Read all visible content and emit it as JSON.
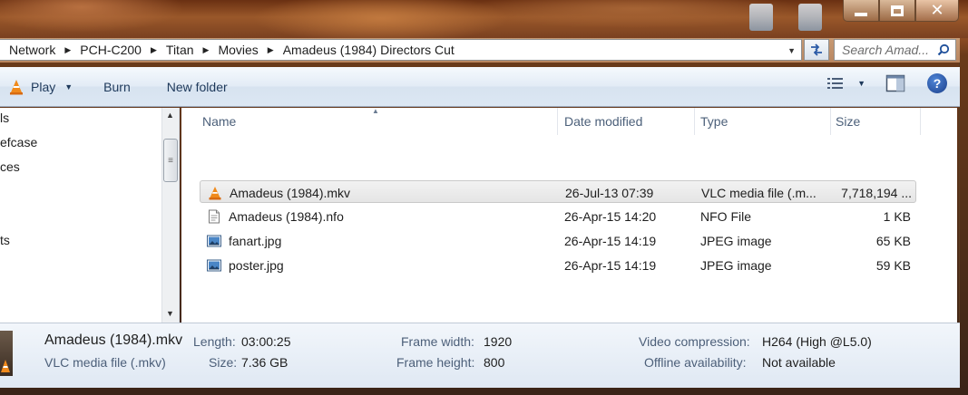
{
  "window": {
    "controls": {
      "minimize": "minimize",
      "maximize": "maximize",
      "close": "✕"
    }
  },
  "address": {
    "crumbs": [
      "Network",
      "PCH-C200",
      "Titan",
      "Movies",
      "Amadeus (1984) Directors Cut"
    ]
  },
  "search": {
    "placeholder": "Search Amad..."
  },
  "toolbar": {
    "play_label": "Play",
    "burn_label": "Burn",
    "new_folder_label": "New folder"
  },
  "nav": {
    "items": [
      "ls",
      "efcase",
      "ces",
      "ts"
    ]
  },
  "columns": {
    "name": "Name",
    "date": "Date modified",
    "type": "Type",
    "size": "Size"
  },
  "files": [
    {
      "name": "Amadeus (1984).mkv",
      "date": "26-Jul-13 07:39",
      "type": "VLC media file (.m...",
      "size": "7,718,194 ...",
      "icon": "vlc-cone-icon",
      "selected": true
    },
    {
      "name": "Amadeus (1984).nfo",
      "date": "26-Apr-15 14:20",
      "type": "NFO File",
      "size": "1 KB",
      "icon": "text-file-icon",
      "selected": false
    },
    {
      "name": "fanart.jpg",
      "date": "26-Apr-15 14:19",
      "type": "JPEG image",
      "size": "65 KB",
      "icon": "image-file-icon",
      "selected": false
    },
    {
      "name": "poster.jpg",
      "date": "26-Apr-15 14:19",
      "type": "JPEG image",
      "size": "59 KB",
      "icon": "image-file-icon",
      "selected": false
    }
  ],
  "details": {
    "title": "Amadeus (1984).mkv",
    "subtitle": "VLC media file (.mkv)",
    "length_label": "Length:",
    "length_value": "03:00:25",
    "size_label": "Size:",
    "size_value": "7.36 GB",
    "frame_width_label": "Frame width:",
    "frame_width_value": "1920",
    "frame_height_label": "Frame height:",
    "frame_height_value": "800",
    "video_compression_label": "Video compression:",
    "video_compression_value": "H264 (High @L5.0)",
    "offline_label": "Offline availability:",
    "offline_value": "Not available"
  },
  "colors": {
    "toolbar_text": "#1e395b",
    "header_text": "#4c607a",
    "selection_bg": "#e5e5e5"
  }
}
